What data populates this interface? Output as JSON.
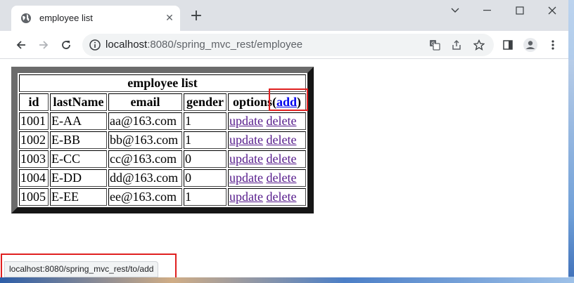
{
  "browser": {
    "tab": {
      "title": "employee list",
      "close_glyph": "✕",
      "favicon": "globe-icon"
    },
    "new_tab_glyph": "+",
    "address": {
      "host": "localhost",
      "path": ":8080/spring_mvc_rest/employee"
    },
    "status_url": "localhost:8080/spring_mvc_rest/to/add"
  },
  "table": {
    "caption": "employee list",
    "headers": {
      "id": "id",
      "lastName": "lastName",
      "email": "email",
      "gender": "gender",
      "options": "options(",
      "add": "add",
      "options_close": ")"
    },
    "rows": [
      {
        "id": "1001",
        "lastName": "E-AA",
        "email": "aa@163.com",
        "gender": "1",
        "update": "update",
        "delete": "delete"
      },
      {
        "id": "1002",
        "lastName": "E-BB",
        "email": "bb@163.com",
        "gender": "1",
        "update": "update",
        "delete": "delete"
      },
      {
        "id": "1003",
        "lastName": "E-CC",
        "email": "cc@163.com",
        "gender": "0",
        "update": "update",
        "delete": "delete"
      },
      {
        "id": "1004",
        "lastName": "E-DD",
        "email": "dd@163.com",
        "gender": "0",
        "update": "update",
        "delete": "delete"
      },
      {
        "id": "1005",
        "lastName": "E-EE",
        "email": "ee@163.com",
        "gender": "1",
        "update": "update",
        "delete": "delete"
      }
    ]
  },
  "colors": {
    "highlight": "#e02020",
    "link": "#551a8b",
    "add_link": "#0000ee",
    "tab_strip": "#dee1e6"
  }
}
